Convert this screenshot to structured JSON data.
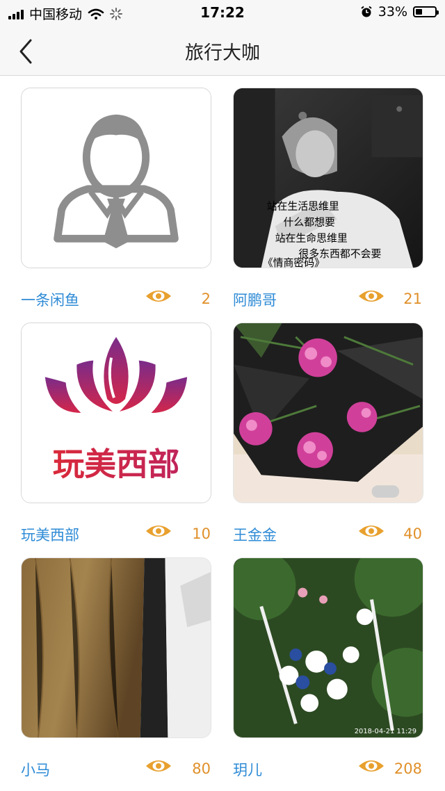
{
  "status_bar": {
    "carrier": "中国移动",
    "time": "17:22",
    "battery_percent": "33%",
    "battery_level": 0.33
  },
  "navbar": {
    "title": "旅行大咖",
    "back_icon": "chevron-left-icon"
  },
  "accent_colors": {
    "name": "#2e8bd6",
    "count": "#e0902a",
    "eye_icon": "#e8a02e"
  },
  "experts": [
    {
      "name": "一条闲鱼",
      "views": "2",
      "image": "default-avatar"
    },
    {
      "name": "阿鹏哥",
      "views": "21",
      "image": "portrait-photo",
      "image_text": [
        "站在生活思维里",
        "什么都想要",
        "站在生命思维里",
        "很多东西都不会要",
        "《情商密码》"
      ]
    },
    {
      "name": "玩美西部",
      "views": "10",
      "image": "lotus-logo",
      "logo_text": "玩美西部"
    },
    {
      "name": "王金金",
      "views": "40",
      "image": "carnation-bouquet"
    },
    {
      "name": "小马",
      "views": "80",
      "image": "wood-surface-photo"
    },
    {
      "name": "玥儿",
      "views": "208",
      "image": "rose-bouquet",
      "image_text": [
        "2018-04-21 11:29"
      ]
    }
  ]
}
